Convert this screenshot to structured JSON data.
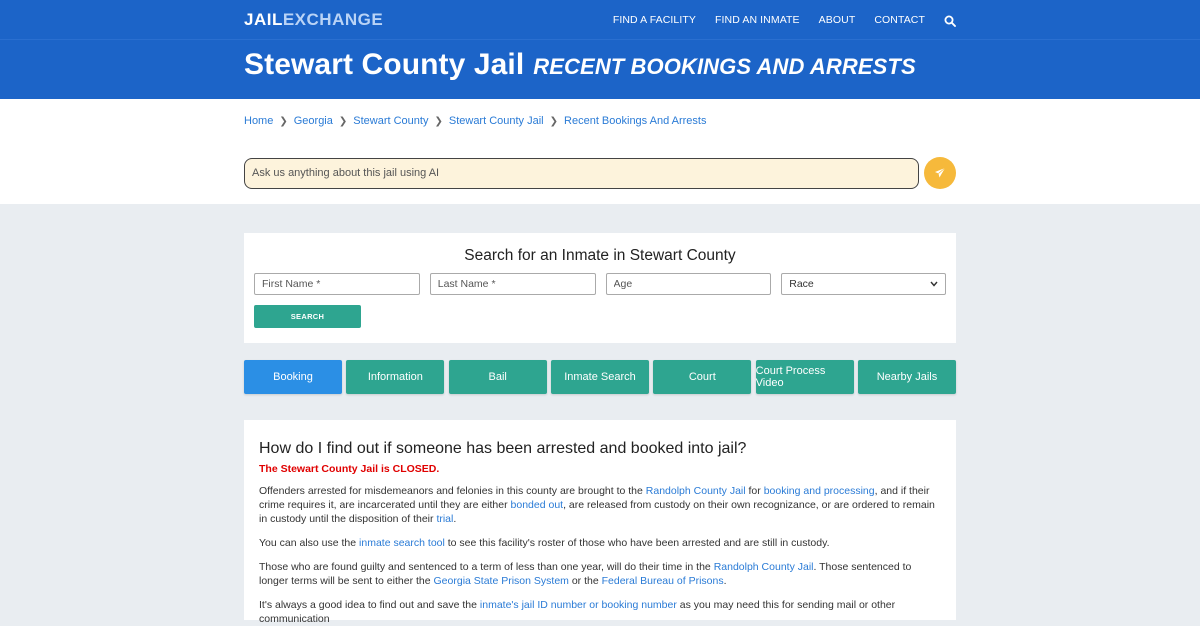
{
  "nav": {
    "logo_part1": "JAIL",
    "logo_part2": "EXCHANGE",
    "links": [
      "FIND A FACILITY",
      "FIND AN INMATE",
      "ABOUT",
      "CONTACT"
    ],
    "search_icon": "search-icon"
  },
  "hero": {
    "title": "Stewart County Jail",
    "subtitle": "RECENT BOOKINGS AND ARRESTS"
  },
  "breadcrumb": [
    "Home",
    "Georgia",
    "Stewart County",
    "Stewart County Jail",
    "Recent Bookings And Arrests"
  ],
  "ai_search": {
    "placeholder": "Ask us anything about this jail using AI",
    "send_icon": "paper-plane-icon"
  },
  "inmate_search": {
    "title": "Search for an Inmate in Stewart County",
    "first_name_placeholder": "First Name *",
    "last_name_placeholder": "Last Name *",
    "age_placeholder": "Age",
    "race_selected": "Race",
    "search_label": "SEARCH"
  },
  "tabs": [
    "Booking",
    "Information",
    "Bail",
    "Inmate Search",
    "Court",
    "Court Process Video",
    "Nearby Jails"
  ],
  "content": {
    "heading": "How do I find out if someone has been arrested and booked into jail?",
    "closed_notice": "The Stewart County Jail is CLOSED.",
    "p1": {
      "t1": "Offenders arrested for misdemeanors and felonies in this county are brought to the ",
      "l1": "Randolph County Jail",
      "t2": " for ",
      "l2": "booking and processing",
      "t3": ", and if their crime requires it, are incarcerated until they are either ",
      "l3": "bonded out",
      "t4": ", are released from custody on their own recognizance, or are ordered to remain in custody until the disposition of their ",
      "l4": "trial",
      "t5": "."
    },
    "p2": {
      "t1": "You can also use the ",
      "l1": "inmate search tool",
      "t2": " to see this facility's roster of those who have been arrested and are still in custody."
    },
    "p3": {
      "t1": "Those who are found guilty and sentenced to a term of less than one year, will do their time in the ",
      "l1": "Randolph County Jail",
      "t2": ". Those sentenced to longer terms will be sent to either the ",
      "l2": "Georgia State Prison System",
      "t3": " or the ",
      "l3": "Federal Bureau of Prisons",
      "t4": "."
    },
    "p4": {
      "t1": "It's always a good idea to find out and save the ",
      "l1": "inmate's jail ID number or booking number",
      "t2": " as you may need this for sending mail or other communication"
    }
  },
  "colors": {
    "brand_blue": "#1c64c8",
    "teal": "#2ea590",
    "active_tab": "#2b8fe5",
    "link": "#2a7bd6",
    "closed_red": "#e00000",
    "send_button": "#f6b93b"
  }
}
